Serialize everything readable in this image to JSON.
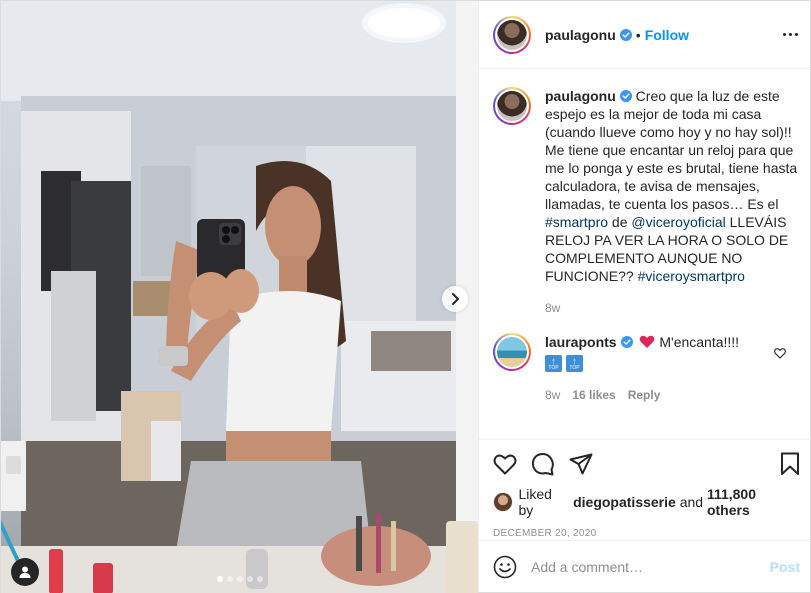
{
  "post": {
    "author": {
      "username": "paulagonu",
      "verified": true,
      "follow_label": "Follow",
      "separator": "•"
    },
    "caption": {
      "username": "paulagonu",
      "text_1": "Creo que la luz de este espejo es la mejor de toda mi casa (cuando llueve como hoy y no hay sol)!! Me tiene que encantar un reloj para que me lo ponga y este es brutal, tiene hasta calculadora, te avisa de mensajes, llamadas, te cuenta los pasos… Es el ",
      "hashtag_1": "#smartpro",
      "text_2": " de ",
      "mention_1": "@viceroyoficial",
      "text_3": " LLEVÁIS RELOJ PA VER LA HORA O SOLO DE COMPLEMENTO AUNQUE NO FUNCIONE?? ",
      "hashtag_2": "#viceroysmartpro",
      "time": "8w"
    },
    "comments": [
      {
        "username": "laurapontsv",
        "username_display": "lauraponts",
        "verified": true,
        "text": "M'encanta!!!!",
        "badge_label": "TOP",
        "time": "8w",
        "likes": "16 likes",
        "reply_label": "Reply"
      }
    ],
    "likes": {
      "prefix": "Liked by ",
      "user": "diegopatisserie",
      "middle": " and ",
      "count": "111,800 others"
    },
    "date": "December 20, 2020",
    "add_comment": {
      "placeholder": "Add a comment…",
      "post_label": "Post"
    },
    "carousel": {
      "total": 5,
      "active": 0
    }
  },
  "colors": {
    "link": "#0095f6",
    "hashtag": "#00376b",
    "muted": "#8e8e8e",
    "post_disabled": "#b2dffc"
  },
  "icons": {
    "more": "more-options-icon",
    "like": "heart-icon",
    "comment": "comment-icon",
    "share": "paper-plane-icon",
    "save": "bookmark-icon",
    "emoji": "emoji-icon",
    "tag": "user-tag-icon",
    "next": "chevron-right-icon"
  }
}
